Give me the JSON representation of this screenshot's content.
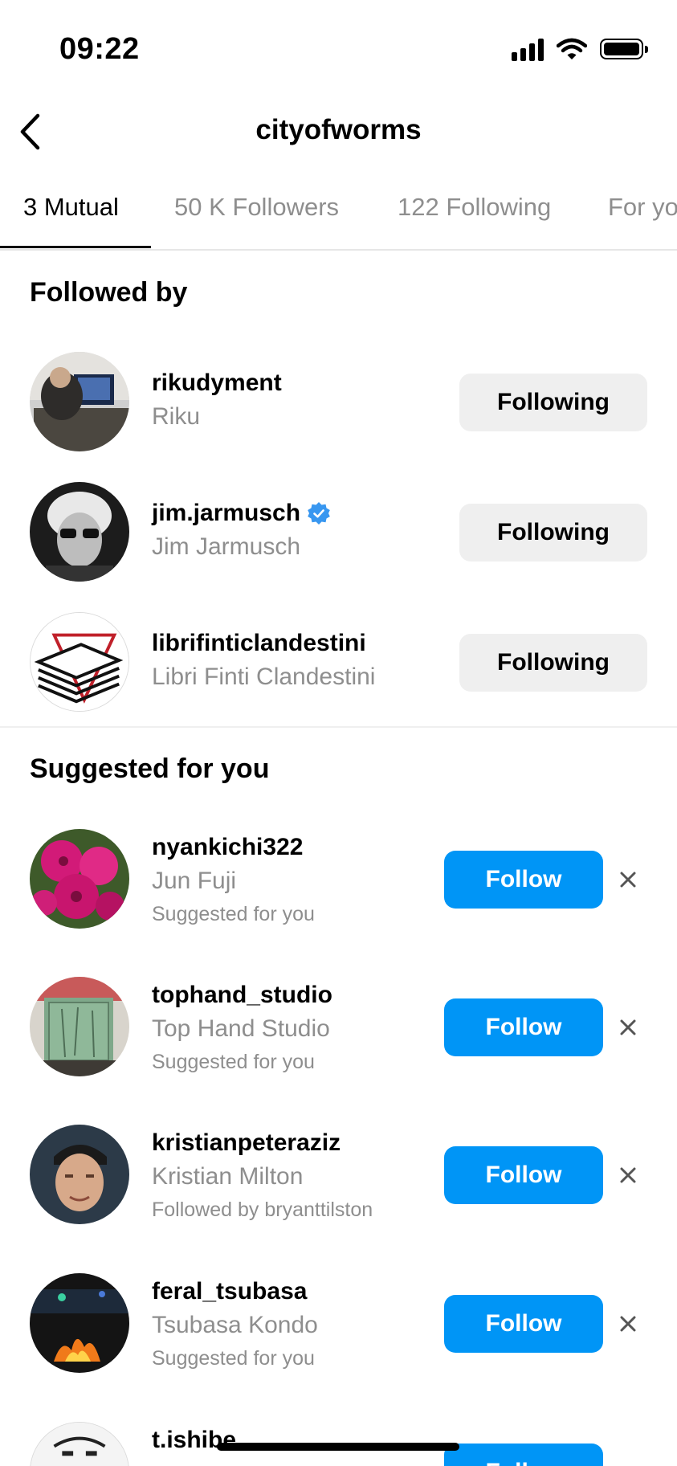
{
  "status": {
    "time": "09:22"
  },
  "header": {
    "title": "cityofworms"
  },
  "tabs": [
    {
      "label": "3 Mutual"
    },
    {
      "label": "50 K Followers"
    },
    {
      "label": "122 Following"
    },
    {
      "label": "For yo"
    }
  ],
  "followed_by": {
    "title": "Followed by",
    "items": [
      {
        "username": "rikudyment",
        "fullname": "Riku",
        "button": "Following",
        "verified": false
      },
      {
        "username": "jim.jarmusch",
        "fullname": "Jim Jarmusch",
        "button": "Following",
        "verified": true
      },
      {
        "username": "librifinticlandestini",
        "fullname": "Libri Finti Clandestini",
        "button": "Following",
        "verified": false
      }
    ]
  },
  "suggested": {
    "title": "Suggested for you",
    "items": [
      {
        "username": "nyankichi322",
        "fullname": "Jun  Fuji",
        "subtext": "Suggested for you",
        "button": "Follow"
      },
      {
        "username": "tophand_studio",
        "fullname": "Top Hand Studio",
        "subtext": "Suggested for you",
        "button": "Follow"
      },
      {
        "username": "kristianpeteraziz",
        "fullname": "Kristian Milton",
        "subtext": "Followed by bryanttilston",
        "button": "Follow"
      },
      {
        "username": "feral_tsubasa",
        "fullname": "Tsubasa Kondo",
        "subtext": "Suggested for you",
        "button": "Follow"
      },
      {
        "username": "t.ishibe",
        "fullname": "",
        "subtext": "",
        "button": "Follow"
      }
    ]
  },
  "colors": {
    "accent": "#0095f6",
    "secondary_text": "#8e8e8e",
    "button_bg": "#efefef",
    "verified": "#3897f0"
  },
  "icons": {
    "back": "chevron-left-icon",
    "verified": "verified-badge-icon",
    "dismiss": "close-icon",
    "signal": "cellular-signal-icon",
    "wifi": "wifi-icon",
    "battery": "battery-icon"
  }
}
